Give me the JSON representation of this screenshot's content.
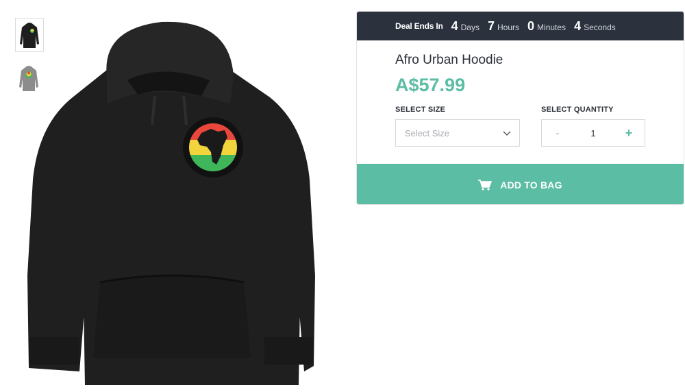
{
  "product": {
    "title": "Afro Urban Hoodie",
    "price": "A$57.99"
  },
  "deal": {
    "label": "Deal Ends In",
    "days_value": "4",
    "days_label": "Days",
    "hours_value": "7",
    "hours_label": "Hours",
    "minutes_value": "0",
    "minutes_label": "Minutes",
    "seconds_value": "4",
    "seconds_label": "Seconds"
  },
  "options": {
    "size_label": "SELECT SIZE",
    "size_placeholder": "Select Size",
    "quantity_label": "SELECT QUANTITY",
    "quantity_value": "1",
    "minus": "-",
    "plus": "+"
  },
  "cta": {
    "label": "ADD TO BAG"
  },
  "thumbnails": [
    {
      "name": "black-hoodie-thumbnail",
      "color": "#1e1e1e"
    },
    {
      "name": "grey-hoodie-thumbnail",
      "color": "#8c8c8c"
    }
  ],
  "colors": {
    "accent": "#5bbda4",
    "deal_bar": "#2b313d",
    "hoodie": "#1e1e1e",
    "flag_red": "#e9473c",
    "flag_yellow": "#f2d43c",
    "flag_green": "#3fb65a"
  }
}
